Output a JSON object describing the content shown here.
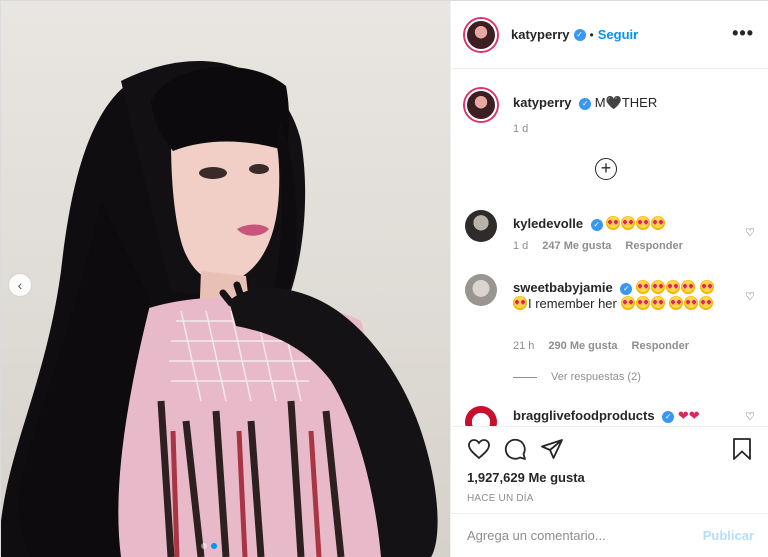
{
  "post": {
    "author": "katyperry",
    "follow_label": "Seguir",
    "separator": "•",
    "more_label": "•••"
  },
  "caption": {
    "author": "katyperry",
    "text_before": "M",
    "text_heart": "🖤",
    "text_after": "THER",
    "age": "1 d"
  },
  "comments": [
    {
      "author": "kyledevolle",
      "age": "1 d",
      "likes": "247 Me gusta",
      "reply_label": "Responder"
    },
    {
      "author": "sweetbabyjamie",
      "text": "I remember her",
      "age": "21 h",
      "likes": "290 Me gusta",
      "reply_label": "Responder"
    },
    {
      "author": "bragglivefoodproducts"
    }
  ],
  "view_replies": "Ver respuestas (2)",
  "likes_total": "1,927,629 Me gusta",
  "posted": "HACE UN DÍA",
  "composer": {
    "placeholder": "Agrega un comentario...",
    "post_label": "Publicar"
  },
  "icons": {
    "like": "heart-outline-icon",
    "comment": "comment-bubble-icon",
    "share": "paper-plane-icon",
    "save": "bookmark-icon",
    "load_more": "plus-circle-icon",
    "verified": "verified-badge-icon",
    "prev": "chevron-left-icon"
  },
  "colors": {
    "accent": "#0095f6",
    "verified": "#3897f0",
    "muted": "#8e8e8e",
    "publish_disabled": "#b2dffc"
  }
}
